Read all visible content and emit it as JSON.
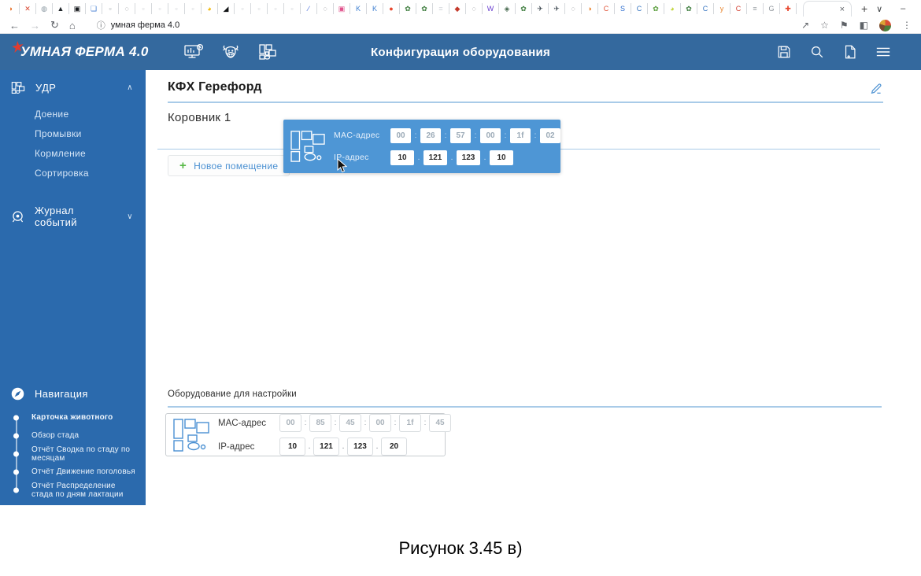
{
  "browser": {
    "favicons": [
      {
        "g": "◗",
        "c": "#e8712a"
      },
      {
        "g": "✕",
        "c": "#d8452e"
      },
      {
        "g": "◍",
        "c": "#8b98a2"
      },
      {
        "g": "▲",
        "c": "#1f2428"
      },
      {
        "g": "▣",
        "c": "#15181b"
      },
      {
        "g": "❏",
        "c": "#3f7ad1"
      },
      {
        "g": "▫",
        "c": "#9aa0a6"
      },
      {
        "g": "◌",
        "c": "#5f6368"
      },
      {
        "g": "▫",
        "c": "#c7ccd1"
      },
      {
        "g": "▫",
        "c": "#c7ccd1"
      },
      {
        "g": "▫",
        "c": "#c7ccd1"
      },
      {
        "g": "▫",
        "c": "#c7ccd1"
      },
      {
        "g": "◕",
        "c": "#f2b705"
      },
      {
        "g": "◢",
        "c": "#101214"
      },
      {
        "g": "▫",
        "c": "#c7ccd1"
      },
      {
        "g": "▫",
        "c": "#c7ccd1"
      },
      {
        "g": "▫",
        "c": "#c7ccd1"
      },
      {
        "g": "▫",
        "c": "#c7ccd1"
      },
      {
        "g": "∕",
        "c": "#3b63d8"
      },
      {
        "g": "◌",
        "c": "#5f6368"
      },
      {
        "g": "▣",
        "c": "#e0528c"
      },
      {
        "g": "K",
        "c": "#3e7fd0"
      },
      {
        "g": "K",
        "c": "#3e7fd0"
      },
      {
        "g": "●",
        "c": "#e8472e"
      },
      {
        "g": "✿",
        "c": "#3e7d3e"
      },
      {
        "g": "✿",
        "c": "#3e7d3e"
      },
      {
        "g": "=",
        "c": "#b9bec4"
      },
      {
        "g": "◆",
        "c": "#c43a2c"
      },
      {
        "g": "◌",
        "c": "#5f6368"
      },
      {
        "g": "W",
        "c": "#6a3fd0"
      },
      {
        "g": "◈",
        "c": "#46694e"
      },
      {
        "g": "✿",
        "c": "#3e7d3e"
      },
      {
        "g": "✈",
        "c": "#3c474f"
      },
      {
        "g": "✈",
        "c": "#3c474f"
      },
      {
        "g": "◌",
        "c": "#5f6368"
      },
      {
        "g": "◑",
        "c": "#e87a1e"
      },
      {
        "g": "C",
        "c": "#e05438"
      },
      {
        "g": "S",
        "c": "#2f6fd0"
      },
      {
        "g": "C",
        "c": "#3a77c2"
      },
      {
        "g": "✿",
        "c": "#5a9e3d"
      },
      {
        "g": "◕",
        "c": "#c3d63e"
      },
      {
        "g": "✿",
        "c": "#3e7d3e"
      },
      {
        "g": "C",
        "c": "#3a77c2"
      },
      {
        "g": "y",
        "c": "#e8832a"
      },
      {
        "g": "C",
        "c": "#d23f31"
      },
      {
        "g": "≡",
        "c": "#9aa0a6"
      },
      {
        "g": "G",
        "c": "#8f959b"
      },
      {
        "g": "✚",
        "c": "#e8472e"
      }
    ],
    "active_tab_close": "×",
    "new_tab": "+",
    "window_controls": {
      "menu": "∨",
      "minimize": "–",
      "maximize": "▢",
      "close": "✕"
    },
    "addressbar": {
      "back": "←",
      "forward": "→",
      "reload": "↻",
      "home": "⌂",
      "info": "ⓘ",
      "url": "умная ферма 4.0",
      "share": "↗",
      "bookmark": "☆",
      "extensions": "⚑",
      "side_panel": "◧",
      "menu": "⋮"
    }
  },
  "header": {
    "logo_star": "★",
    "logo_text": "УМНАЯ ФЕРМА 4.0",
    "title": "Конфигурация оборудования"
  },
  "sidebar": {
    "udr": {
      "label": "УДР",
      "chevron": "∧",
      "items": [
        "Доение",
        "Промывки",
        "Кормление",
        "Сортировка"
      ]
    },
    "events": {
      "label": "Журнал событий",
      "chevron": "∨"
    },
    "navigation": {
      "label": "Навигация",
      "items": [
        {
          "label": "Карточка животного",
          "w": "700"
        },
        {
          "label": "Обзор стада",
          "w": "400"
        },
        {
          "label": "Отчёт Сводка по стаду по месяцам",
          "w": "400"
        },
        {
          "label": "Отчёт Движение поголовья",
          "w": "400"
        },
        {
          "label": "Отчёт Распределение стада по дням лактации",
          "w": "400"
        }
      ]
    }
  },
  "main": {
    "farm_title": "КФХ Герефорд",
    "room_title": "Коровник 1",
    "new_room_button": {
      "plus": "+",
      "label": "Новое помещение"
    },
    "popup": {
      "mac_label": "MAC-адрес",
      "ip_label": "IP-адрес",
      "mac": [
        "00",
        "26",
        "57",
        "00",
        "1f",
        "02"
      ],
      "ip": [
        "10",
        "121",
        "123",
        "10"
      ],
      "mac_sep": ":",
      "ip_sep": "."
    },
    "equipment_section": {
      "label": "Оборудование для настройки",
      "card": {
        "mac_label": "MAC-адрес",
        "ip_label": "IP-адрес",
        "mac": [
          "00",
          "85",
          "45",
          "00",
          "1f",
          "45"
        ],
        "ip": [
          "10",
          "121",
          "123",
          "20"
        ],
        "mac_sep": ":",
        "ip_sep": "."
      }
    }
  },
  "caption": "Рисунок 3.45 в)",
  "colors": {
    "header_blue": "#34699e",
    "sidebar_blue": "#2b6aad",
    "popup_blue": "#4e96d5",
    "accent_line": "#a9cbe8",
    "link_blue": "#4a90d2",
    "plus_green": "#58b947"
  }
}
